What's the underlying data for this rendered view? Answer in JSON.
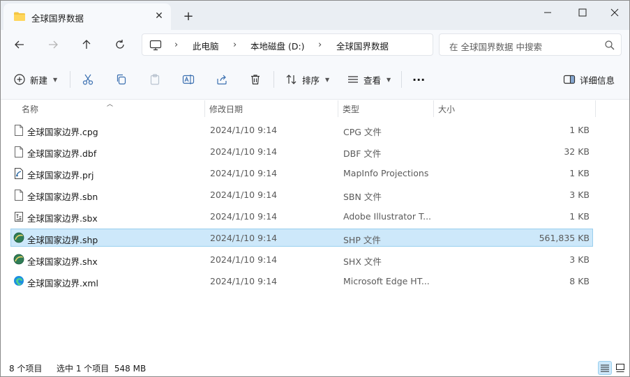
{
  "tab": {
    "title": "全球国界数据",
    "close": "✕",
    "new_tab": "+"
  },
  "address": {
    "crumbs": [
      "此电脑",
      "本地磁盘 (D:)",
      "全球国界数据"
    ],
    "separator": "›"
  },
  "search": {
    "placeholder": "在 全球国界数据 中搜索"
  },
  "toolbar": {
    "new_label": "新建",
    "sort_label": "排序",
    "view_label": "查看",
    "more_label": "···",
    "details_label": "详细信息"
  },
  "columns": {
    "name": "名称",
    "date": "修改日期",
    "type": "类型",
    "size": "大小"
  },
  "files": [
    {
      "name": "全球国家边界.cpg",
      "date": "2024/1/10 9:14",
      "type": "CPG 文件",
      "size": "1 KB",
      "icon": "doc-icon"
    },
    {
      "name": "全球国家边界.dbf",
      "date": "2024/1/10 9:14",
      "type": "DBF 文件",
      "size": "32 KB",
      "icon": "doc-icon"
    },
    {
      "name": "全球国家边界.prj",
      "date": "2024/1/10 9:14",
      "type": "MapInfo Projections",
      "size": "1 KB",
      "icon": "mapinfo-icon"
    },
    {
      "name": "全球国家边界.sbn",
      "date": "2024/1/10 9:14",
      "type": "SBN 文件",
      "size": "3 KB",
      "icon": "doc-icon"
    },
    {
      "name": "全球国家边界.sbx",
      "date": "2024/1/10 9:14",
      "type": "Adobe Illustrator T...",
      "size": "1 KB",
      "icon": "text-doc-icon"
    },
    {
      "name": "全球国家边界.shp",
      "date": "2024/1/10 9:14",
      "type": "SHP 文件",
      "size": "561,835 KB",
      "icon": "globe-app-icon",
      "selected": true
    },
    {
      "name": "全球国家边界.shx",
      "date": "2024/1/10 9:14",
      "type": "SHX 文件",
      "size": "3 KB",
      "icon": "globe-app-icon"
    },
    {
      "name": "全球国家边界.xml",
      "date": "2024/1/10 9:14",
      "type": "Microsoft Edge HT...",
      "size": "8 KB",
      "icon": "edge-icon"
    }
  ],
  "status": {
    "count": "8 个项目",
    "selection": "选中 1 个项目  548 MB"
  },
  "colors": {
    "selection_bg": "#cde8fa",
    "selection_border": "#99cfee",
    "folder": "#f4c542"
  }
}
